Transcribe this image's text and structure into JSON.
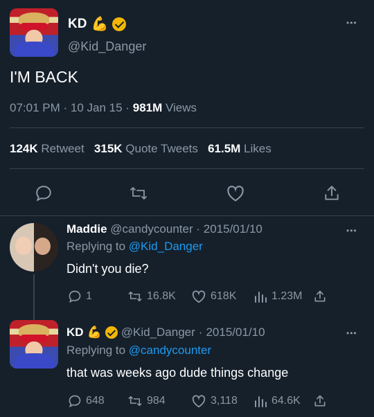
{
  "main_tweet": {
    "display_name": "KD",
    "emoji": "💪",
    "handle": "@Kid_Danger",
    "text": "I'M BACK",
    "time": "07:01 PM",
    "date": "10 Jan 15",
    "views_count": "981M",
    "views_label": "Views",
    "retweets_count": "124K",
    "retweets_label": "Retweet",
    "quotes_count": "315K",
    "quotes_label": "Quote Tweets",
    "likes_count": "61.5M",
    "likes_label": "Likes"
  },
  "reply1": {
    "display_name": "Maddie",
    "handle": "@candycounter",
    "date": "2015/01/10",
    "replying_prefix": "Replying to",
    "replying_to": "@Kid_Danger",
    "text": "Didn't you die?",
    "reply_count": "1",
    "retweet_count": "16.8K",
    "like_count": "618K",
    "view_count": "1.23M"
  },
  "reply2": {
    "display_name": "KD",
    "emoji": "💪",
    "handle": "@Kid_Danger",
    "date": "2015/01/10",
    "replying_prefix": "Replying to",
    "replying_to": "@candycounter",
    "text": "that was weeks ago dude things change",
    "reply_count": "648",
    "retweet_count": "984",
    "like_count": "3,118",
    "view_count": "64.6K"
  },
  "separator": "·",
  "more_glyph": "•••",
  "colors": {
    "background": "#15202b",
    "muted": "#8b98a5",
    "link": "#1d9bf0",
    "divider": "#38444d",
    "verified": "#f2b705"
  }
}
